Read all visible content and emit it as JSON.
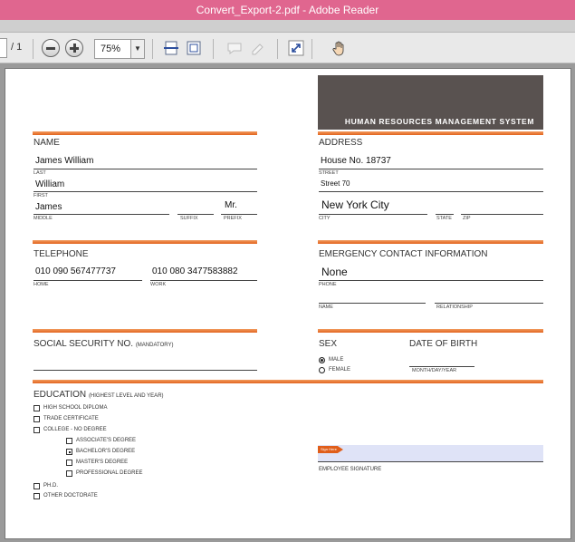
{
  "window": {
    "title": "Convert_Export-2.pdf - Adobe Reader"
  },
  "toolbar": {
    "page_count": "/ 1",
    "zoom": "75%",
    "icons": [
      "zoom-out-icon",
      "zoom-in-icon",
      "fit-width-icon",
      "fit-page-icon",
      "comment-icon",
      "highlight-icon",
      "fullscreen-icon",
      "hand-tool-icon"
    ]
  },
  "form": {
    "banner_title": "HUMAN RESOURCES MANAGEMENT SYSTEM",
    "name": {
      "heading": "NAME",
      "last_value": "James William",
      "last_label": "LAST",
      "first_value": "William",
      "first_label": "FIRST",
      "middle_value": "James",
      "middle_label": "MIDDLE",
      "suffix_label": "SUFFIX",
      "prefix_value": "Mr.",
      "prefix_label": "PREFIX"
    },
    "address": {
      "heading": "ADDRESS",
      "line1_value": "House No. 18737",
      "street_label": "STREET",
      "street_value": "Street 70",
      "city_value": "New York City",
      "city_label": "CITY",
      "state_label": "STATE",
      "zip_label": "ZIP"
    },
    "telephone": {
      "heading": "TELEPHONE",
      "home_value": "010 090 567477737",
      "home_label": "HOME",
      "work_value": "010 080 3477583882",
      "work_label": "WORK"
    },
    "emergency": {
      "heading": "EMERGENCY CONTACT INFORMATION",
      "phone_value": "None",
      "phone_label": "PHONE",
      "name_label": "NAME",
      "relationship_label": "RELATIONSHIP"
    },
    "ssn": {
      "heading": "SOCIAL SECURITY NO.",
      "note": "(MANDATORY)"
    },
    "sex": {
      "heading": "SEX",
      "options": [
        {
          "label": "MALE",
          "selected": true
        },
        {
          "label": "FEMALE",
          "selected": false
        }
      ]
    },
    "dob": {
      "heading": "DATE OF BIRTH",
      "label": "MONTH/DAY/YEAR"
    },
    "education": {
      "heading": "EDUCATION",
      "note": "(HIGHEST LEVEL AND YEAR)",
      "options": [
        {
          "label": "HIGH SCHOOL DIPLOMA",
          "checked": false
        },
        {
          "label": "TRADE CERTIFICATE",
          "checked": false
        },
        {
          "label": "COLLEGE - NO DEGREE",
          "checked": false
        },
        {
          "label": "ASSOCIATE'S DEGREE",
          "checked": false
        },
        {
          "label": "BACHELOR'S DEGREE",
          "checked": true
        },
        {
          "label": "MASTER'S DEGREE",
          "checked": false
        },
        {
          "label": "PROFESSIONAL DEGREE",
          "checked": false
        },
        {
          "label": "PH.D.",
          "checked": false
        },
        {
          "label": "OTHER DOCTORATE",
          "checked": false
        }
      ]
    },
    "signature": {
      "label": "EMPLOYEE SIGNATURE",
      "tag": "Sign Here"
    }
  },
  "colors": {
    "titlebar": "#e0668f",
    "accent_orange": "#e2641e",
    "banner": "#595250"
  }
}
